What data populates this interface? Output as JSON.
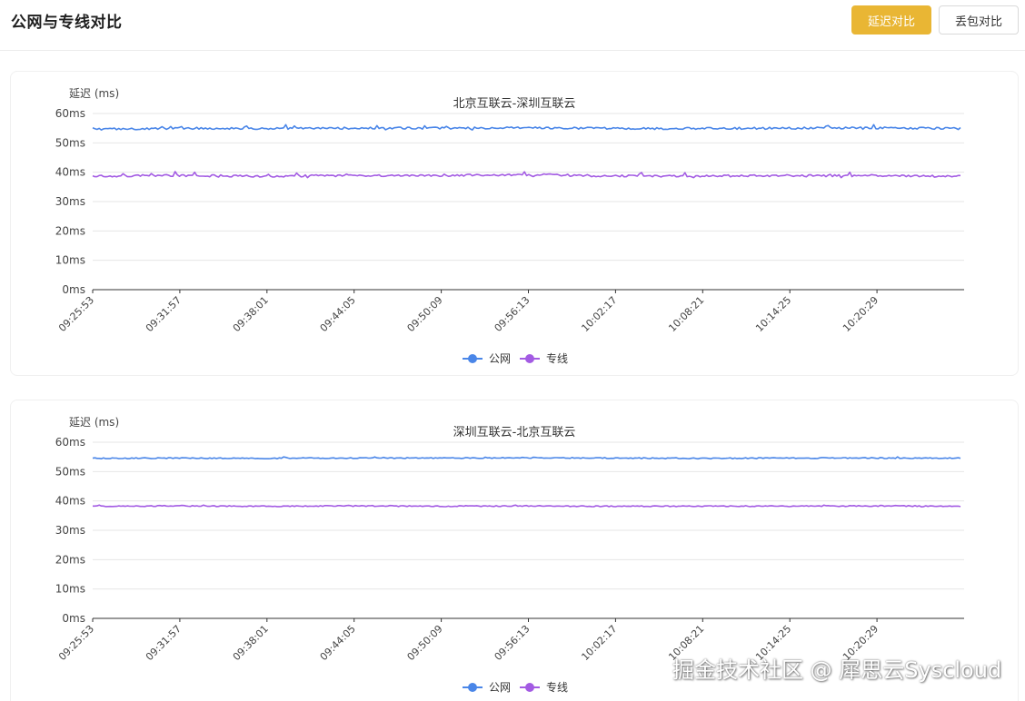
{
  "header": {
    "title": "公网与专线对比",
    "latency_button": "延迟对比",
    "loss_button": "丢包对比"
  },
  "colors": {
    "accent": "#e9b634",
    "public": "#4a86e8",
    "dedicated": "#a35be3"
  },
  "watermark": "掘金技术社区 @ 犀思云Syscloud",
  "chart_data": [
    {
      "type": "line",
      "title": "北京互联云-深圳互联云",
      "ylabel": "延迟 (ms)",
      "ylim": [
        0,
        60
      ],
      "yticks": [
        "0ms",
        "10ms",
        "20ms",
        "30ms",
        "40ms",
        "50ms",
        "60ms"
      ],
      "x": [
        "09:25:53",
        "09:31:57",
        "09:38:01",
        "09:44:05",
        "09:50:09",
        "09:56:13",
        "10:02:17",
        "10:08:21",
        "10:14:25",
        "10:20:29"
      ],
      "grid": true,
      "legend": "bottom-center",
      "series": [
        {
          "name": "公网",
          "color": "#4a86e8",
          "values": [
            54.7,
            55.0,
            54.9,
            55.0,
            55.0,
            55.1,
            54.9,
            54.9,
            55.0,
            55.1,
            54.9
          ]
        },
        {
          "name": "专线",
          "color": "#a35be3",
          "values": [
            38.7,
            38.9,
            38.6,
            38.9,
            38.9,
            39.2,
            38.7,
            38.7,
            38.8,
            38.8,
            38.6
          ]
        }
      ]
    },
    {
      "type": "line",
      "title": "深圳互联云-北京互联云",
      "ylabel": "延迟 (ms)",
      "ylim": [
        0,
        60
      ],
      "yticks": [
        "0ms",
        "10ms",
        "20ms",
        "30ms",
        "40ms",
        "50ms",
        "60ms"
      ],
      "x": [
        "09:25:53",
        "09:31:57",
        "09:38:01",
        "09:44:05",
        "09:50:09",
        "09:56:13",
        "10:02:17",
        "10:08:21",
        "10:14:25",
        "10:20:29"
      ],
      "grid": true,
      "legend": "bottom-center",
      "series": [
        {
          "name": "公网",
          "color": "#4a86e8",
          "values": [
            54.5,
            54.6,
            54.5,
            54.6,
            54.6,
            54.7,
            54.6,
            54.5,
            54.6,
            54.6,
            54.6
          ]
        },
        {
          "name": "专线",
          "color": "#a35be3",
          "values": [
            38.2,
            38.3,
            38.2,
            38.3,
            38.2,
            38.3,
            38.2,
            38.2,
            38.2,
            38.3,
            38.2
          ]
        }
      ]
    }
  ]
}
